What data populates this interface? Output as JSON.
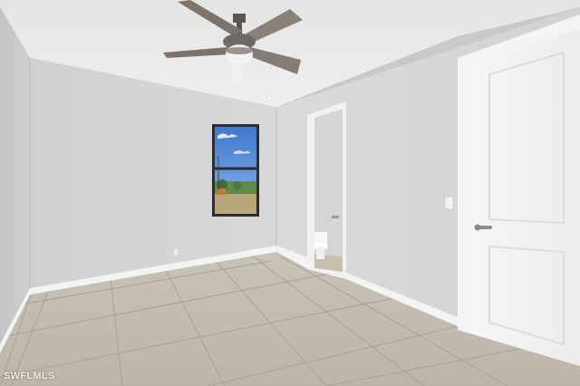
{
  "watermark": {
    "text": "SWFLMLS"
  },
  "colors": {
    "ceiling": "#e9e9e8",
    "wall_left": "#cfcfd0",
    "wall_back": "#d6d6d7",
    "wall_right": "#dbdbdc",
    "floor": "#c3bdb0",
    "grout": "#a9a294",
    "baseboard": "#f5f5f5",
    "door": "#f3f3f3",
    "sky": "#4d86d6",
    "fan_body": "#6e6a66",
    "fan_blade": "#8a8178"
  },
  "scene": {
    "objects": [
      "ceiling-fan",
      "window",
      "bathroom-doorway",
      "toilet",
      "closet-door",
      "door-handle",
      "light-switch",
      "wall-outlet",
      "tile-floor",
      "baseboard"
    ]
  }
}
